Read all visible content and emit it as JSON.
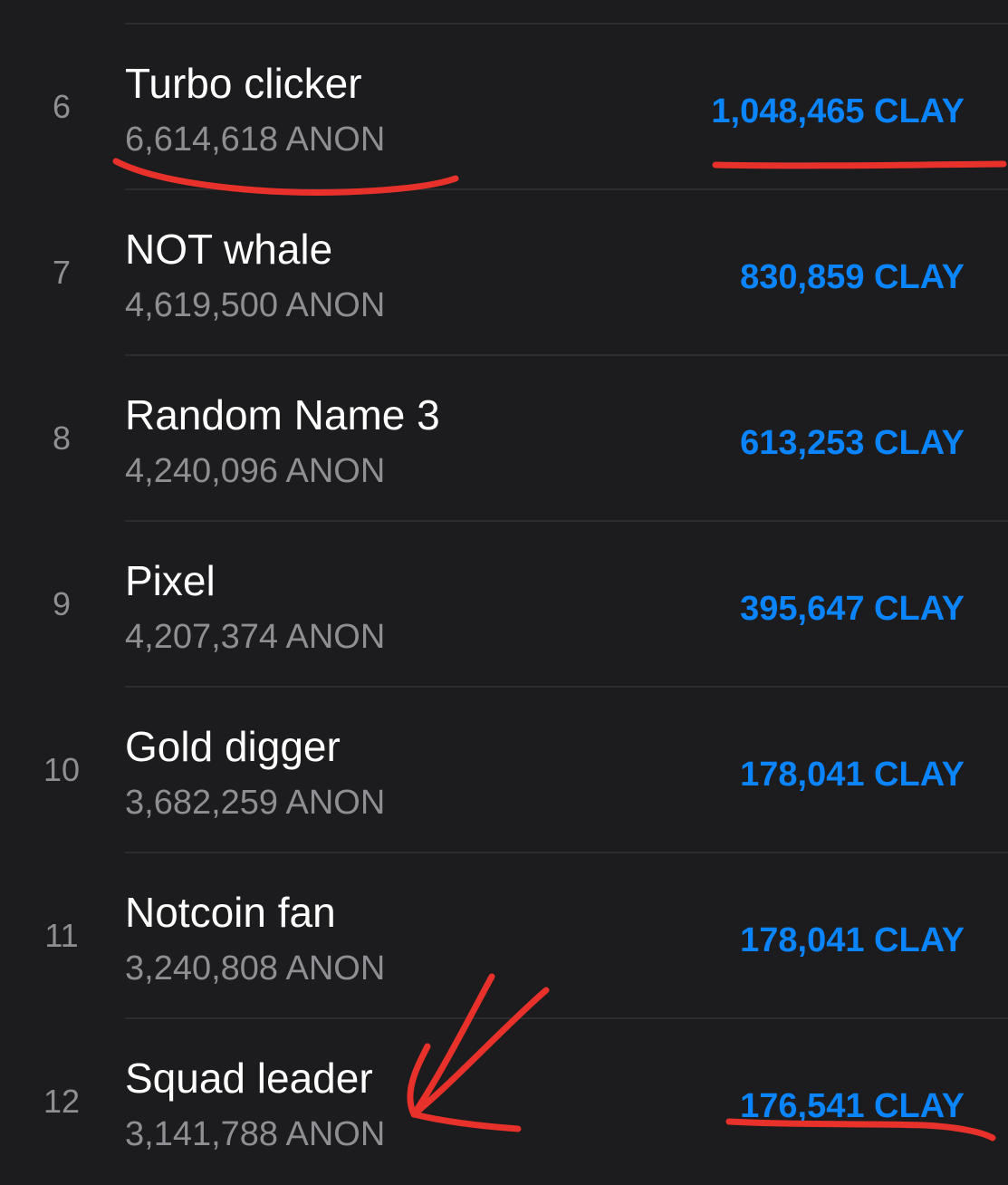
{
  "leaderboard": {
    "rows": [
      {
        "rank": "6",
        "name": "Turbo clicker",
        "balance": "6,614,618 ANON",
        "score": "1,048,465 CLAY"
      },
      {
        "rank": "7",
        "name": "NOT whale",
        "balance": "4,619,500 ANON",
        "score": "830,859 CLAY"
      },
      {
        "rank": "8",
        "name": "Random Name 3",
        "balance": "4,240,096 ANON",
        "score": "613,253 CLAY"
      },
      {
        "rank": "9",
        "name": "Pixel",
        "balance": "4,207,374 ANON",
        "score": "395,647 CLAY"
      },
      {
        "rank": "10",
        "name": "Gold digger",
        "balance": "3,682,259 ANON",
        "score": "178,041 CLAY"
      },
      {
        "rank": "11",
        "name": "Notcoin fan",
        "balance": "3,240,808 ANON",
        "score": "178,041 CLAY"
      },
      {
        "rank": "12",
        "name": "Squad leader",
        "balance": "3,141,788 ANON",
        "score": "176,541 CLAY"
      }
    ]
  },
  "colors": {
    "background": "#1c1c1e",
    "divider": "#2c2c2e",
    "primary_text": "#ffffff",
    "secondary_text": "#8e8e93",
    "accent": "#0a84ff",
    "annotation": "#e8312a"
  },
  "annotations": {
    "underlines": [
      "row-6-balance",
      "row-6-score",
      "row-12-score"
    ],
    "arrow_target": "row-12"
  }
}
